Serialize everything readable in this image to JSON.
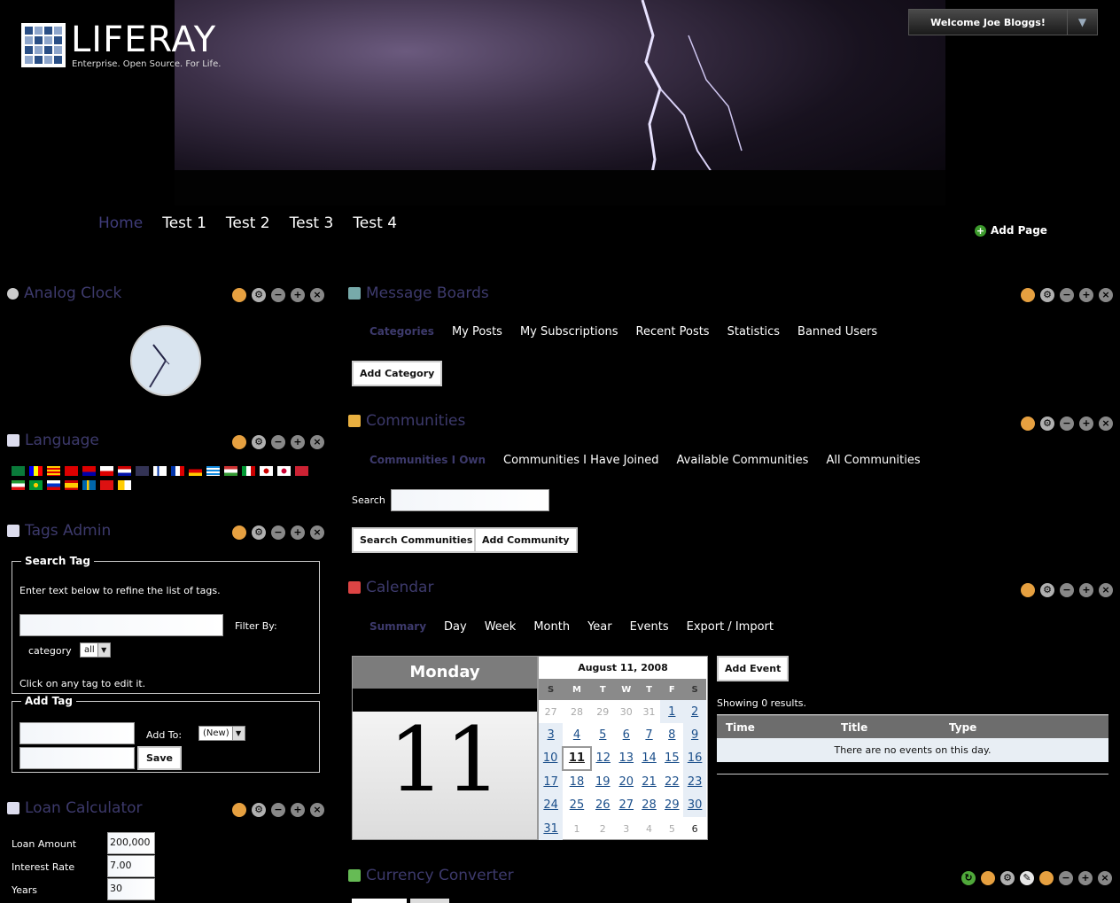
{
  "header": {
    "logo_text": "LIFERAY",
    "logo_tagline": "Enterprise. Open Source. For Life.",
    "welcome": "Welcome Joe Bloggs!",
    "add_page": "Add Page"
  },
  "nav": {
    "items": [
      {
        "label": "Home",
        "selected": true
      },
      {
        "label": "Test 1"
      },
      {
        "label": "Test 2"
      },
      {
        "label": "Test 3"
      },
      {
        "label": "Test 4"
      }
    ]
  },
  "left": {
    "clock": {
      "title": "Analog Clock"
    },
    "language": {
      "title": "Language"
    },
    "tags": {
      "title": "Tags Admin",
      "search_legend": "Search Tag",
      "search_hint": "Enter text below to refine the list of tags.",
      "filter_by": "Filter By:",
      "category_label": "category",
      "category_value": "all",
      "edit_hint": "Click on any tag to edit it.",
      "add_legend": "Add Tag",
      "add_to_label": "Add To:",
      "add_to_value": "(New)",
      "save": "Save"
    },
    "loan": {
      "title": "Loan Calculator",
      "loan_amount_label": "Loan Amount",
      "loan_amount": "200,000",
      "interest_rate_label": "Interest Rate",
      "interest_rate": "7.00",
      "years_label": "Years",
      "years": "30"
    }
  },
  "message_boards": {
    "title": "Message Boards",
    "tabs": [
      "Categories",
      "My Posts",
      "My Subscriptions",
      "Recent Posts",
      "Statistics",
      "Banned Users"
    ],
    "add_category": "Add Category"
  },
  "communities": {
    "title": "Communities",
    "tabs": [
      "Communities I Own",
      "Communities I Have Joined",
      "Available Communities",
      "All Communities"
    ],
    "search_label": "Search",
    "search_button": "Search Communities",
    "add_button": "Add Community"
  },
  "calendar": {
    "title": "Calendar",
    "tabs": [
      "Summary",
      "Day",
      "Week",
      "Month",
      "Year",
      "Events",
      "Export / Import"
    ],
    "day_name": "Monday",
    "day_number": "11",
    "month_title": "August 11, 2008",
    "weekdays": [
      "S",
      "M",
      "T",
      "W",
      "T",
      "F",
      "S"
    ],
    "weeks": [
      [
        "27",
        "28",
        "29",
        "30",
        "31",
        "1",
        "2"
      ],
      [
        "3",
        "4",
        "5",
        "6",
        "7",
        "8",
        "9"
      ],
      [
        "10",
        "11",
        "12",
        "13",
        "14",
        "15",
        "16"
      ],
      [
        "17",
        "18",
        "19",
        "20",
        "21",
        "22",
        "23"
      ],
      [
        "24",
        "25",
        "26",
        "27",
        "28",
        "29",
        "30"
      ],
      [
        "31",
        "1",
        "2",
        "3",
        "4",
        "5",
        "6"
      ]
    ],
    "add_event": "Add Event",
    "results": "Showing 0 results.",
    "col_time": "Time",
    "col_title": "Title",
    "col_type": "Type",
    "empty": "There are no events on this day."
  },
  "currency": {
    "title": "Currency Converter"
  }
}
